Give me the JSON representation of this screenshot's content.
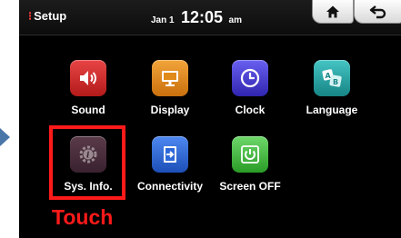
{
  "header": {
    "title": "Setup",
    "date": "Jan 1",
    "time": "12:05",
    "ampm": "am",
    "home_icon": "home-icon",
    "back_icon": "back-arrow-icon"
  },
  "apps": [
    {
      "label": "Sound",
      "icon": "speaker-icon",
      "color": "#d22a2a"
    },
    {
      "label": "Display",
      "icon": "monitor-icon",
      "color": "#e08a1a"
    },
    {
      "label": "Clock",
      "icon": "clock-icon",
      "color": "#4a3fd6"
    },
    {
      "label": "Language",
      "icon": "language-icon",
      "color": "#2aa6a6"
    },
    {
      "label": "Sys. Info.",
      "icon": "info-gear-icon",
      "color": "#4a2c3a"
    },
    {
      "label": "Connectivity",
      "icon": "connect-icon",
      "color": "#2d68d8"
    },
    {
      "label": "Screen OFF",
      "icon": "power-icon",
      "color": "#3fbf3a"
    }
  ],
  "annotation": {
    "touch_label": "Touch",
    "color": "#ff1a1a"
  }
}
